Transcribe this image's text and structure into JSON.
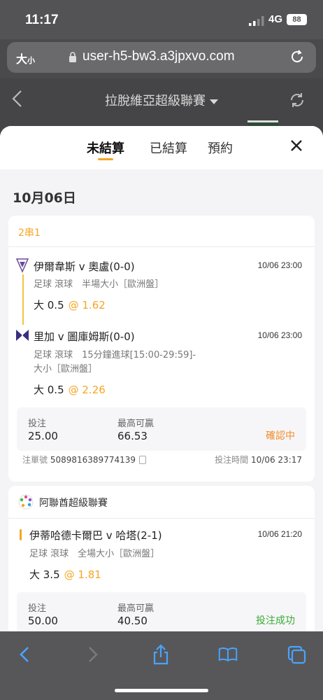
{
  "status_bar": {
    "time": "11:17",
    "network": "4G",
    "battery": "88"
  },
  "browser": {
    "text_size_label": "大",
    "text_size_small": "小",
    "url": "user-h5-bw3.a3jpxvo.com"
  },
  "app_header": {
    "title": "拉脫維亞超級聯賽"
  },
  "tabs": [
    {
      "label": "未結算",
      "active": true
    },
    {
      "label": "已結算",
      "active": false
    },
    {
      "label": "預約",
      "active": false
    }
  ],
  "date": "10月06日",
  "bet1": {
    "type": "2串1",
    "legs": [
      {
        "match": "伊爾韋斯 v 奧盧(0-0)",
        "time": "10/06 23:00",
        "market": "足球 滾球　半場大小［歐洲盤］",
        "selection": "大 0.5",
        "odds": "@ 1.62"
      },
      {
        "match": "里加 v 圖庫姆斯(0-0)",
        "time": "10/06 23:00",
        "market_line1": "足球 滾球　15分鐘進球[15:00-29:59]-",
        "market_line2": "大小［歐洲盤］",
        "selection": "大 0.5",
        "odds": "@ 2.26"
      }
    ],
    "stake_label": "投注",
    "stake": "25.00",
    "max_win_label": "最高可贏",
    "max_win": "66.53",
    "status": "確認中",
    "bet_no_label": "注單號",
    "bet_no": "5089816389774139",
    "bet_time_label": "投注時間",
    "bet_time": "10/06 23:17"
  },
  "bet2": {
    "league": "阿聯酋超級聯賽",
    "match": "伊蒂哈德卡爾巴 v 哈塔(2-1)",
    "time": "10/06 21:20",
    "market": "足球 滾球　全場大小［歐洲盤］",
    "selection": "大 3.5",
    "odds": "@ 1.81",
    "stake_label": "投注",
    "stake": "50.00",
    "max_win_label": "最高可贏",
    "max_win": "40.50",
    "status": "投注成功"
  },
  "colors": {
    "accent": "#f5a623",
    "pending": "#f28c28",
    "success": "#3aaa35"
  }
}
